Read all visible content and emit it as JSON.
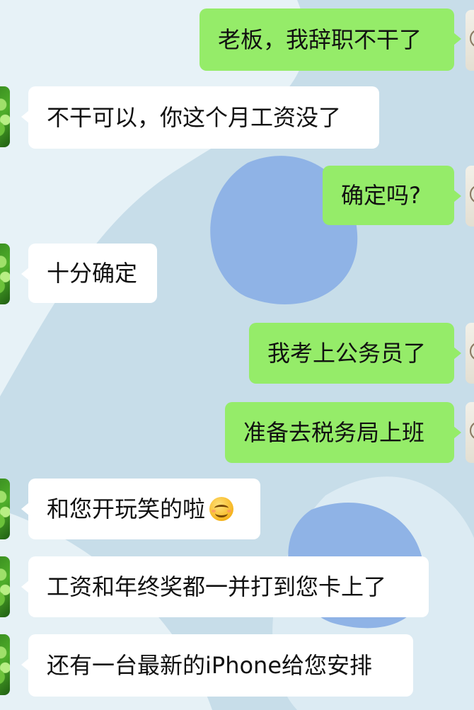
{
  "messages": [
    {
      "side": "right",
      "text": "老板，我辞职不干了"
    },
    {
      "side": "left",
      "text": "不干可以，你这个月工资没了"
    },
    {
      "side": "right",
      "text": "确定吗?"
    },
    {
      "side": "left",
      "text": "十分确定"
    },
    {
      "side": "right",
      "text": "我考上公务员了"
    },
    {
      "side": "right",
      "text": "准备去税务局上班"
    },
    {
      "side": "left",
      "text": "和您开玩笑的啦",
      "emoji": "smiling-face-emoji"
    },
    {
      "side": "left",
      "text": "工资和年终奖都一并打到您卡上了"
    },
    {
      "side": "left",
      "text": "还有一台最新的iPhone给您安排"
    }
  ],
  "colors": {
    "outgoing_bubble": "#95ec69",
    "incoming_bubble": "#ffffff",
    "background": "#c5dbe8"
  }
}
